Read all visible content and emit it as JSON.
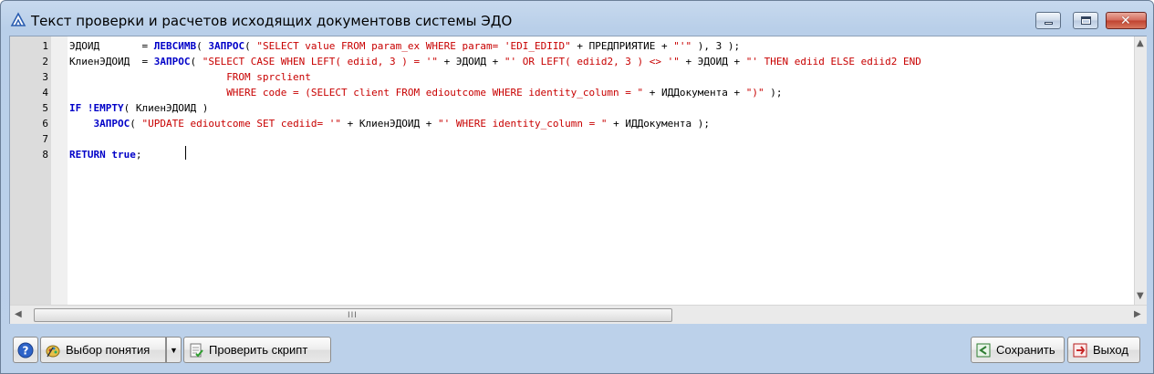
{
  "window": {
    "title": "Текст проверки и расчетов исходящих документовв системы ЭДО",
    "close_glyph": "✕"
  },
  "editor": {
    "lines": [
      {
        "num": "1",
        "tokens": [
          {
            "t": "ЭДОИД       = ",
            "c": ""
          },
          {
            "t": "ЛЕВСИМВ",
            "c": "fn"
          },
          {
            "t": "( ",
            "c": ""
          },
          {
            "t": "ЗАПРОС",
            "c": "fn"
          },
          {
            "t": "( ",
            "c": ""
          },
          {
            "t": "\"SELECT value FROM param_ex WHERE param= 'EDI_EDIID\"",
            "c": "str"
          },
          {
            "t": " + ПРЕДПРИЯТИЕ + ",
            "c": ""
          },
          {
            "t": "\"'\"",
            "c": "str"
          },
          {
            "t": " ), 3 );",
            "c": ""
          }
        ]
      },
      {
        "num": "2",
        "tokens": [
          {
            "t": "КлиенЭДОИД  = ",
            "c": ""
          },
          {
            "t": "ЗАПРОС",
            "c": "fn"
          },
          {
            "t": "( ",
            "c": ""
          },
          {
            "t": "\"SELECT CASE WHEN LEFT( ediid, 3 ) = '\"",
            "c": "str"
          },
          {
            "t": " + ЭДОИД + ",
            "c": ""
          },
          {
            "t": "\"' OR LEFT( ediid2, 3 ) <> '\"",
            "c": "str"
          },
          {
            "t": " + ЭДОИД + ",
            "c": ""
          },
          {
            "t": "\"' THEN ediid ELSE ediid2 END",
            "c": "str"
          }
        ]
      },
      {
        "num": "3",
        "tokens": [
          {
            "t": "                          ",
            "c": ""
          },
          {
            "t": "FROM sprclient",
            "c": "str"
          }
        ]
      },
      {
        "num": "4",
        "tokens": [
          {
            "t": "                          ",
            "c": ""
          },
          {
            "t": "WHERE code = (SELECT client FROM edioutcome WHERE identity_column = \"",
            "c": "str"
          },
          {
            "t": " + ИДДокумента + ",
            "c": ""
          },
          {
            "t": "\")\"",
            "c": "str"
          },
          {
            "t": " );",
            "c": ""
          }
        ]
      },
      {
        "num": "5",
        "tokens": [
          {
            "t": "IF !",
            "c": "kw"
          },
          {
            "t": "EMPTY",
            "c": "fn"
          },
          {
            "t": "( КлиенЭДОИД )",
            "c": ""
          }
        ]
      },
      {
        "num": "6",
        "tokens": [
          {
            "t": "    ",
            "c": ""
          },
          {
            "t": "ЗАПРОС",
            "c": "fn"
          },
          {
            "t": "( ",
            "c": ""
          },
          {
            "t": "\"UPDATE edioutcome SET cediid= '\"",
            "c": "str"
          },
          {
            "t": " + КлиенЭДОИД + ",
            "c": ""
          },
          {
            "t": "\"' WHERE identity_column = \"",
            "c": "str"
          },
          {
            "t": " + ИДДокумента );",
            "c": ""
          }
        ]
      },
      {
        "num": "7",
        "tokens": []
      },
      {
        "num": "8",
        "tokens": [
          {
            "t": "RETURN true",
            "c": "kw"
          },
          {
            "t": ";",
            "c": ""
          }
        ]
      }
    ],
    "hscroll_left_arrow": "◀",
    "hscroll_right_arrow": "▶",
    "vscroll_up_arrow": "▲",
    "vscroll_down_arrow": "▼",
    "hscroll_grip": "III"
  },
  "toolbar": {
    "help_label": "",
    "concept_label": "Выбор понятия",
    "concept_drop_glyph": "▼",
    "check_label": "Проверить скрипт",
    "save_label": "Сохранить",
    "exit_label": "Выход"
  },
  "colors": {
    "keyword": "#0000c8",
    "string": "#c80000",
    "title_bg": "#c7d9ee"
  }
}
